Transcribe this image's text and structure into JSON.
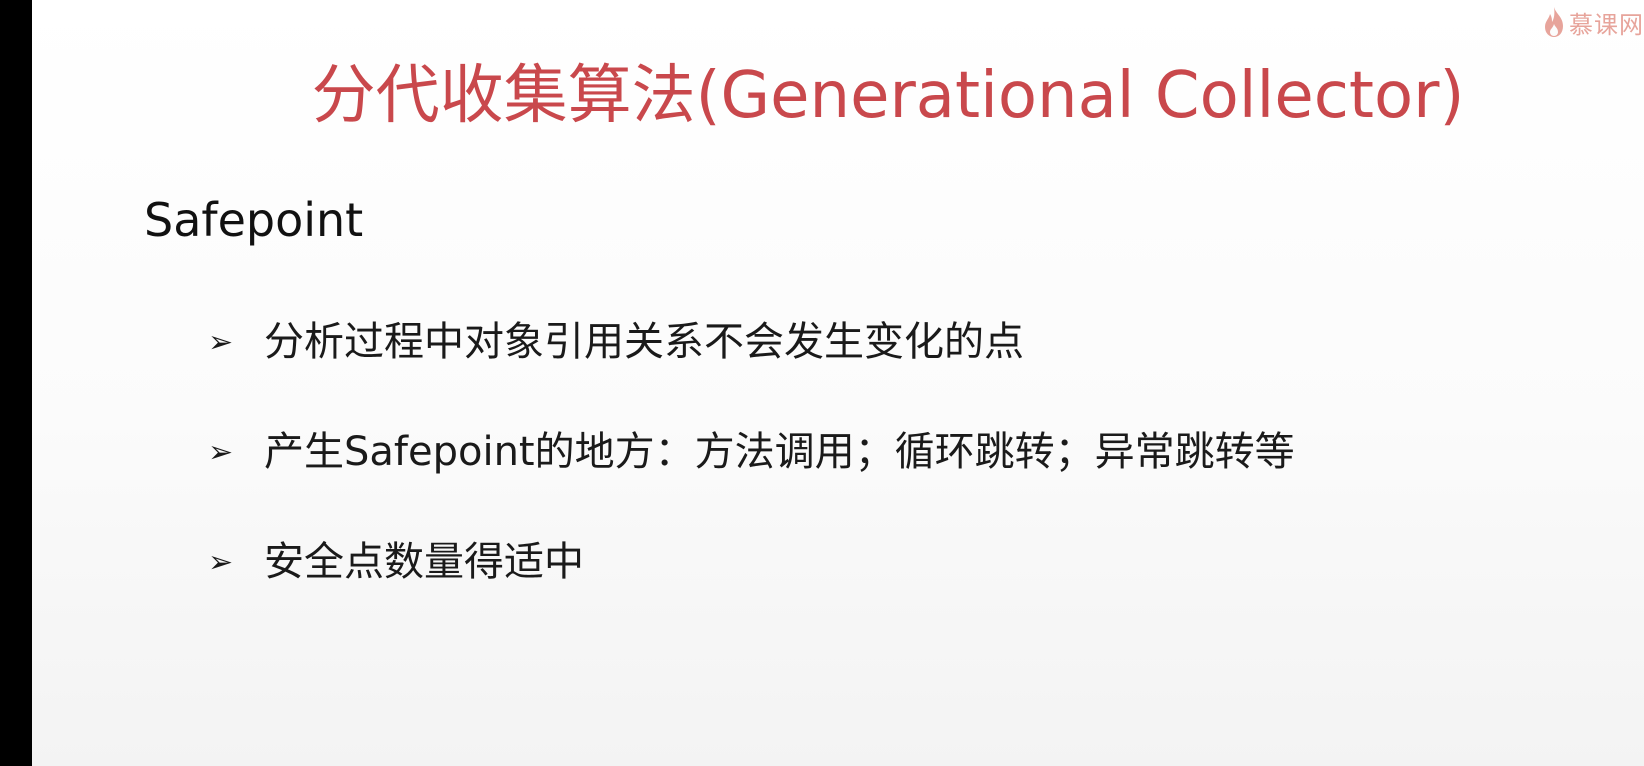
{
  "slide": {
    "title": "分代收集算法(Generational Collector)",
    "subtitle": "Safepoint",
    "bullet_marker": "➢",
    "bullets": [
      "分析过程中对象引用关系不会发生变化的点",
      "产生Safepoint的地方：方法调用；循环跳转；异常跳转等",
      "安全点数量得适中"
    ]
  },
  "watermark": {
    "text": "慕课网",
    "icon": "flame-icon"
  },
  "colors": {
    "title": "#c9484c",
    "text": "#1a1a1a",
    "background": "#ffffff",
    "frame": "#000000",
    "watermark": "#e0867a"
  }
}
